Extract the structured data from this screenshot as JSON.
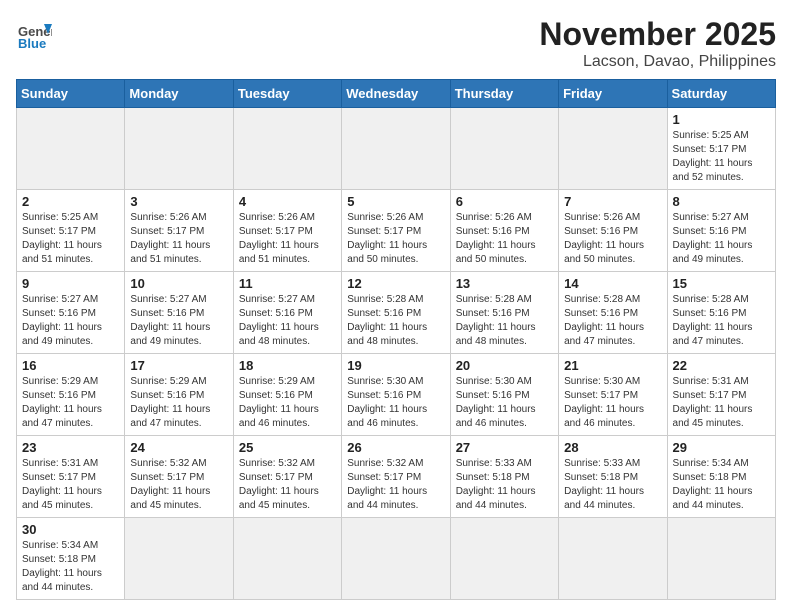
{
  "header": {
    "logo_general": "General",
    "logo_blue": "Blue",
    "title": "November 2025",
    "subtitle": "Lacson, Davao, Philippines"
  },
  "days_of_week": [
    "Sunday",
    "Monday",
    "Tuesday",
    "Wednesday",
    "Thursday",
    "Friday",
    "Saturday"
  ],
  "weeks": [
    [
      {
        "day": "",
        "info": ""
      },
      {
        "day": "",
        "info": ""
      },
      {
        "day": "",
        "info": ""
      },
      {
        "day": "",
        "info": ""
      },
      {
        "day": "",
        "info": ""
      },
      {
        "day": "",
        "info": ""
      },
      {
        "day": "1",
        "info": "Sunrise: 5:25 AM\nSunset: 5:17 PM\nDaylight: 11 hours\nand 52 minutes."
      }
    ],
    [
      {
        "day": "2",
        "info": "Sunrise: 5:25 AM\nSunset: 5:17 PM\nDaylight: 11 hours\nand 51 minutes."
      },
      {
        "day": "3",
        "info": "Sunrise: 5:26 AM\nSunset: 5:17 PM\nDaylight: 11 hours\nand 51 minutes."
      },
      {
        "day": "4",
        "info": "Sunrise: 5:26 AM\nSunset: 5:17 PM\nDaylight: 11 hours\nand 51 minutes."
      },
      {
        "day": "5",
        "info": "Sunrise: 5:26 AM\nSunset: 5:17 PM\nDaylight: 11 hours\nand 50 minutes."
      },
      {
        "day": "6",
        "info": "Sunrise: 5:26 AM\nSunset: 5:16 PM\nDaylight: 11 hours\nand 50 minutes."
      },
      {
        "day": "7",
        "info": "Sunrise: 5:26 AM\nSunset: 5:16 PM\nDaylight: 11 hours\nand 50 minutes."
      },
      {
        "day": "8",
        "info": "Sunrise: 5:27 AM\nSunset: 5:16 PM\nDaylight: 11 hours\nand 49 minutes."
      }
    ],
    [
      {
        "day": "9",
        "info": "Sunrise: 5:27 AM\nSunset: 5:16 PM\nDaylight: 11 hours\nand 49 minutes."
      },
      {
        "day": "10",
        "info": "Sunrise: 5:27 AM\nSunset: 5:16 PM\nDaylight: 11 hours\nand 49 minutes."
      },
      {
        "day": "11",
        "info": "Sunrise: 5:27 AM\nSunset: 5:16 PM\nDaylight: 11 hours\nand 48 minutes."
      },
      {
        "day": "12",
        "info": "Sunrise: 5:28 AM\nSunset: 5:16 PM\nDaylight: 11 hours\nand 48 minutes."
      },
      {
        "day": "13",
        "info": "Sunrise: 5:28 AM\nSunset: 5:16 PM\nDaylight: 11 hours\nand 48 minutes."
      },
      {
        "day": "14",
        "info": "Sunrise: 5:28 AM\nSunset: 5:16 PM\nDaylight: 11 hours\nand 47 minutes."
      },
      {
        "day": "15",
        "info": "Sunrise: 5:28 AM\nSunset: 5:16 PM\nDaylight: 11 hours\nand 47 minutes."
      }
    ],
    [
      {
        "day": "16",
        "info": "Sunrise: 5:29 AM\nSunset: 5:16 PM\nDaylight: 11 hours\nand 47 minutes."
      },
      {
        "day": "17",
        "info": "Sunrise: 5:29 AM\nSunset: 5:16 PM\nDaylight: 11 hours\nand 47 minutes."
      },
      {
        "day": "18",
        "info": "Sunrise: 5:29 AM\nSunset: 5:16 PM\nDaylight: 11 hours\nand 46 minutes."
      },
      {
        "day": "19",
        "info": "Sunrise: 5:30 AM\nSunset: 5:16 PM\nDaylight: 11 hours\nand 46 minutes."
      },
      {
        "day": "20",
        "info": "Sunrise: 5:30 AM\nSunset: 5:16 PM\nDaylight: 11 hours\nand 46 minutes."
      },
      {
        "day": "21",
        "info": "Sunrise: 5:30 AM\nSunset: 5:17 PM\nDaylight: 11 hours\nand 46 minutes."
      },
      {
        "day": "22",
        "info": "Sunrise: 5:31 AM\nSunset: 5:17 PM\nDaylight: 11 hours\nand 45 minutes."
      }
    ],
    [
      {
        "day": "23",
        "info": "Sunrise: 5:31 AM\nSunset: 5:17 PM\nDaylight: 11 hours\nand 45 minutes."
      },
      {
        "day": "24",
        "info": "Sunrise: 5:32 AM\nSunset: 5:17 PM\nDaylight: 11 hours\nand 45 minutes."
      },
      {
        "day": "25",
        "info": "Sunrise: 5:32 AM\nSunset: 5:17 PM\nDaylight: 11 hours\nand 45 minutes."
      },
      {
        "day": "26",
        "info": "Sunrise: 5:32 AM\nSunset: 5:17 PM\nDaylight: 11 hours\nand 44 minutes."
      },
      {
        "day": "27",
        "info": "Sunrise: 5:33 AM\nSunset: 5:18 PM\nDaylight: 11 hours\nand 44 minutes."
      },
      {
        "day": "28",
        "info": "Sunrise: 5:33 AM\nSunset: 5:18 PM\nDaylight: 11 hours\nand 44 minutes."
      },
      {
        "day": "29",
        "info": "Sunrise: 5:34 AM\nSunset: 5:18 PM\nDaylight: 11 hours\nand 44 minutes."
      }
    ],
    [
      {
        "day": "30",
        "info": "Sunrise: 5:34 AM\nSunset: 5:18 PM\nDaylight: 11 hours\nand 44 minutes."
      },
      {
        "day": "",
        "info": ""
      },
      {
        "day": "",
        "info": ""
      },
      {
        "day": "",
        "info": ""
      },
      {
        "day": "",
        "info": ""
      },
      {
        "day": "",
        "info": ""
      },
      {
        "day": "",
        "info": ""
      }
    ]
  ]
}
